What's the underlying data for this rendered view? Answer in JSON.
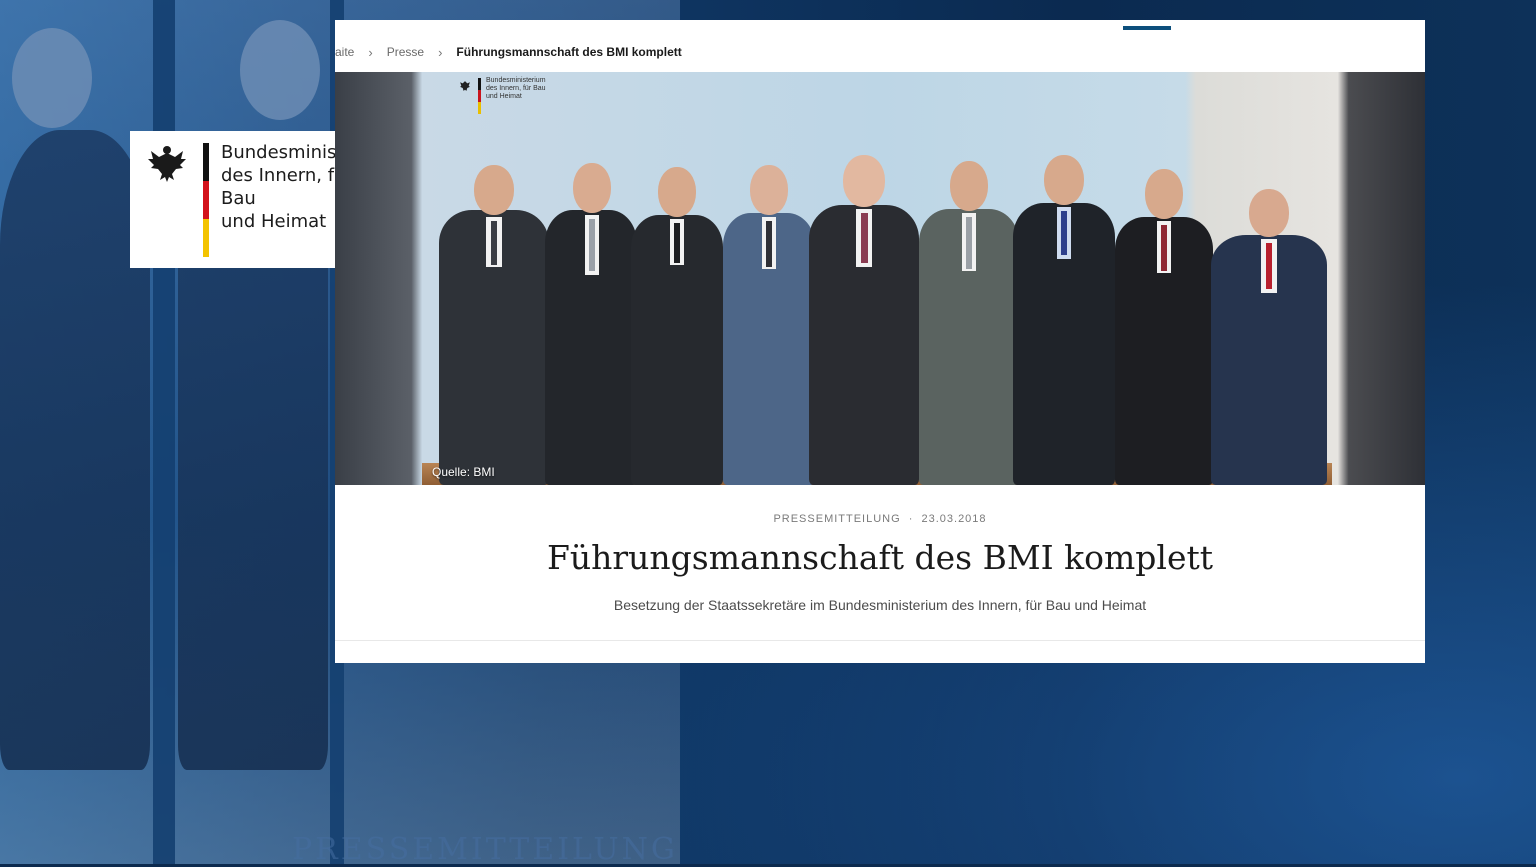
{
  "logo": {
    "line1": "Bundesministerium",
    "line2": "des Innern, für Bau",
    "line3": "und Heimat"
  },
  "breadcrumb": {
    "items": [
      "aite",
      "Presse"
    ],
    "current": "Führungsmannschaft des BMI komplett"
  },
  "photo": {
    "credit": "Quelle: BMI",
    "logo_line1": "Bundesministerium",
    "logo_line2": "des Innern, für Bau",
    "logo_line3": "und Heimat"
  },
  "article": {
    "category": "PRESSEMITTEILUNG",
    "separator": "·",
    "date": "23.03.2018",
    "title": "Führungsmannschaft des BMI komplett",
    "subtitle": "Besetzung der Staatssekretäre im Bundesministerium des Innern, für Bau und Heimat"
  },
  "background": {
    "footer_text": "PRESSEMITTEILUNG"
  },
  "colors": {
    "flag_black": "#111111",
    "flag_red": "#d3121b",
    "flag_gold": "#f3c300",
    "accent": "#0d4f7c"
  }
}
